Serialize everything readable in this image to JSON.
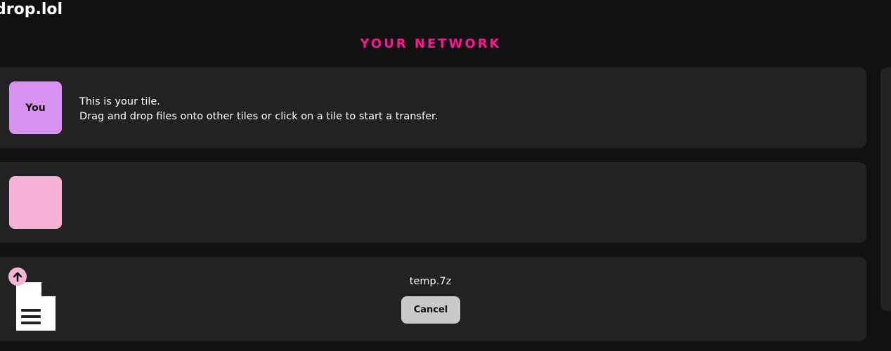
{
  "app": {
    "title": "drop.lol"
  },
  "network": {
    "heading": "YOUR NETWORK",
    "accent_color": "#ff1493"
  },
  "tiles": {
    "you": {
      "avatar_label": "You",
      "avatar_color": "#d792ef",
      "line1": "This is your tile.",
      "line2": "Drag and drop files onto other tiles or click on a tile to start a transfer."
    },
    "peer": {
      "avatar_color": "#f6b3d5"
    },
    "transfer": {
      "icon": "file-upload-icon",
      "file_name": "temp.7z",
      "cancel_label": "Cancel"
    }
  }
}
